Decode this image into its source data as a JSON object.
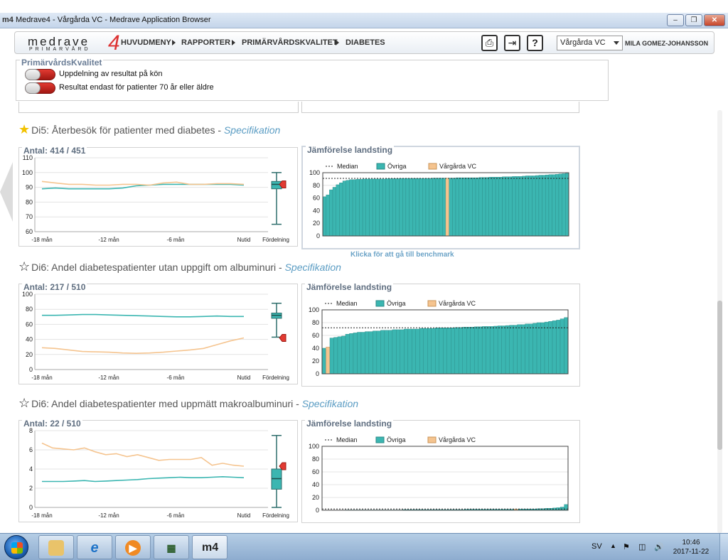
{
  "window": {
    "title": "Medrave4 - Vårgårda VC - Medrave Application Browser",
    "logo": "m4"
  },
  "nav": {
    "brand_main": "medrave",
    "brand_sub": "PRIMARVÅRD",
    "brand_num": "4",
    "items": [
      "HUVUDMENY",
      "RAPPORTER",
      "PRIMÄRVÅRDSKVALITET",
      "DIABETES"
    ],
    "unit_select": "Vårgårda VC",
    "user": "MILA GOMEZ-JOHANSSON",
    "icons": [
      "printer-icon",
      "exit-icon",
      "help-icon"
    ],
    "help_label": "?"
  },
  "filter": {
    "title": "PrimärvårdsKvalitet",
    "toggles": [
      {
        "label": "Uppdelning av resultat på kön",
        "on": false
      },
      {
        "label": "Resultat endast för patienter 70 år eller äldre",
        "on": false
      }
    ]
  },
  "benchmark_link": "Klicka för att gå till benchmark",
  "sections": [
    {
      "title": "Di5: Återbesök för patienter med diabetes -",
      "spec": "Specifikation",
      "starred": true,
      "count_label": "Antal: 414 / 451",
      "compare_title": "Jämförelse landsting"
    },
    {
      "title": "Di6: Andel diabetespatienter utan uppgift om albuminuri -",
      "spec": "Specifikation",
      "starred": false,
      "count_label": "Antal: 217 / 510",
      "compare_title": "Jämförelse landsting"
    },
    {
      "title": "Di6: Andel diabetespatienter med uppmätt makroalbuminuri -",
      "spec": "Specifikation",
      "starred": false,
      "count_label": "Antal: 22 / 510",
      "compare_title": "Jämförelse landsting"
    }
  ],
  "chart_data": [
    {
      "type": "line",
      "title": "Antal: 414 / 451",
      "x_ticks": [
        "-18 mån",
        "-12 mån",
        "-6 mån",
        "Nutid",
        "Fördelning"
      ],
      "ylim": [
        60,
        110
      ],
      "y_ticks": [
        60,
        70,
        80,
        90,
        100,
        110
      ],
      "series": [
        {
          "color": "#3bb6b1",
          "values": [
            89,
            89.5,
            89,
            89,
            89,
            89,
            89.5,
            91,
            91.5,
            92,
            92,
            92,
            92,
            92,
            92,
            91.5
          ]
        },
        {
          "color": "#f5c48f",
          "values": [
            94,
            93,
            92,
            92,
            91.5,
            91.5,
            92,
            92,
            91.5,
            93,
            93.5,
            92,
            92,
            92.5,
            92.5,
            92
          ]
        }
      ],
      "distribution": {
        "min": 65,
        "q1": 89,
        "median": 92,
        "q3": 94,
        "max": 100,
        "current": 92
      }
    },
    {
      "type": "bar",
      "title": "Jämförelse landsting",
      "legend": [
        "Median",
        "Övriga",
        "Vårgårda VC"
      ],
      "ylim": [
        0,
        100
      ],
      "y_ticks": [
        0,
        20,
        40,
        60,
        80,
        100
      ],
      "median": 91,
      "highlight_index": 37,
      "values": [
        62,
        65,
        73,
        77,
        81,
        84,
        87,
        88,
        89,
        89,
        89.5,
        89.5,
        90,
        90,
        90,
        90,
        90,
        90,
        90,
        90.5,
        90.5,
        90.5,
        90.5,
        91,
        91,
        91,
        91,
        91,
        91,
        91,
        91,
        91,
        91,
        91.5,
        91.5,
        91.5,
        91.5,
        91.5,
        91.5,
        91.5,
        92,
        92,
        92,
        92,
        92,
        92,
        92,
        92.5,
        92.5,
        92.5,
        93,
        93,
        93,
        93,
        93.5,
        93.5,
        93.5,
        94,
        94,
        94,
        94.5,
        95,
        95,
        95,
        95.5,
        96,
        96,
        96.5,
        97,
        97,
        97.5,
        98,
        98.5,
        99
      ]
    },
    {
      "type": "line",
      "title": "Antal: 217 / 510",
      "x_ticks": [
        "-18 mån",
        "-12 mån",
        "-6 mån",
        "Nutid",
        "Fördelning"
      ],
      "ylim": [
        0,
        100
      ],
      "y_ticks": [
        0,
        20,
        40,
        60,
        80,
        100
      ],
      "series": [
        {
          "color": "#3bb6b1",
          "values": [
            72,
            72,
            72.5,
            73,
            73,
            72.5,
            72,
            71.5,
            71,
            70.5,
            70,
            70,
            70.5,
            71,
            70.5,
            70.5
          ]
        },
        {
          "color": "#f5c48f",
          "values": [
            29,
            28,
            26,
            24,
            23.5,
            23,
            22,
            21.5,
            22,
            23,
            24.5,
            26,
            28,
            33,
            38,
            42
          ]
        }
      ],
      "distribution": {
        "min": 43,
        "q1": 68,
        "median": 72,
        "q3": 75,
        "max": 88,
        "current": 42
      }
    },
    {
      "type": "bar",
      "title": "Jämförelse landsting",
      "legend": [
        "Median",
        "Övriga",
        "Vårgårda VC"
      ],
      "ylim": [
        0,
        100
      ],
      "y_ticks": [
        0,
        20,
        40,
        60,
        80,
        100
      ],
      "median": 72,
      "highlight_index": 1,
      "values": [
        40,
        42,
        56,
        57,
        58,
        59,
        62,
        63,
        64,
        65,
        65,
        66,
        66,
        67,
        67,
        68,
        68,
        68,
        69,
        69,
        69,
        70,
        70,
        70,
        70,
        71,
        71,
        71,
        71,
        72,
        72,
        72,
        72,
        72,
        72.5,
        72.5,
        73,
        73,
        73,
        73.5,
        73.5,
        74,
        74,
        74,
        74.5,
        75,
        75,
        75.5,
        76,
        76,
        77,
        77,
        78,
        78,
        79,
        80,
        80,
        81,
        82,
        83,
        84,
        86,
        88
      ]
    },
    {
      "type": "line",
      "title": "Antal: 22 / 510",
      "x_ticks": [
        "-18 mån",
        "-12 mån",
        "-6 mån",
        "Nutid",
        "Fördelning"
      ],
      "ylim": [
        0,
        8
      ],
      "y_ticks": [
        0,
        2,
        4,
        6,
        8
      ],
      "series": [
        {
          "color": "#3bb6b1",
          "values": [
            2.7,
            2.7,
            2.7,
            2.75,
            2.8,
            2.7,
            2.75,
            2.8,
            2.85,
            2.9,
            3.0,
            3.05,
            3.1,
            3.15,
            3.1,
            3.1,
            3.15,
            3.2,
            3.15,
            3.1
          ]
        },
        {
          "color": "#f5c48f",
          "values": [
            6.7,
            6.2,
            6.1,
            6.0,
            6.2,
            5.8,
            5.5,
            5.6,
            5.3,
            5.5,
            5.2,
            4.9,
            5.0,
            5.0,
            5.0,
            5.2,
            4.4,
            4.6,
            4.4,
            4.3
          ]
        }
      ],
      "distribution": {
        "min": 0,
        "q1": 1.9,
        "median": 3.0,
        "q3": 4.0,
        "max": 7.5,
        "current": 4.3
      }
    },
    {
      "type": "bar",
      "title": "Jämförelse landsting",
      "legend": [
        "Median",
        "Övriga",
        "Vårgårda VC"
      ],
      "ylim": [
        0,
        100
      ],
      "y_ticks": [
        0,
        20,
        40,
        60,
        80,
        100
      ],
      "median": 2,
      "highlight_index": 50,
      "values": [
        0,
        0,
        0,
        0,
        0,
        0,
        0.5,
        0.5,
        0.5,
        0.5,
        0.5,
        0.5,
        0.5,
        0.5,
        0.5,
        0.5,
        0.5,
        0.5,
        0.5,
        0.5,
        0.5,
        1,
        1,
        1,
        1,
        1,
        1,
        1,
        1,
        1,
        1,
        1,
        1,
        1,
        1,
        1,
        1,
        1.5,
        1.5,
        1.5,
        1.5,
        1.5,
        1.5,
        1.5,
        1.5,
        1.5,
        1.5,
        1.5,
        1.5,
        1.5,
        2,
        2,
        2,
        2,
        2,
        2,
        2.5,
        2.5,
        3,
        3,
        3.5,
        4,
        5,
        9
      ]
    }
  ],
  "taskbar": {
    "apps": [
      "windows-explorer",
      "internet-explorer",
      "media-player",
      "network-app",
      "medrave-app"
    ],
    "medrave_label": "m4",
    "lang": "SV",
    "time": "10:46",
    "date": "2017-11-22"
  }
}
